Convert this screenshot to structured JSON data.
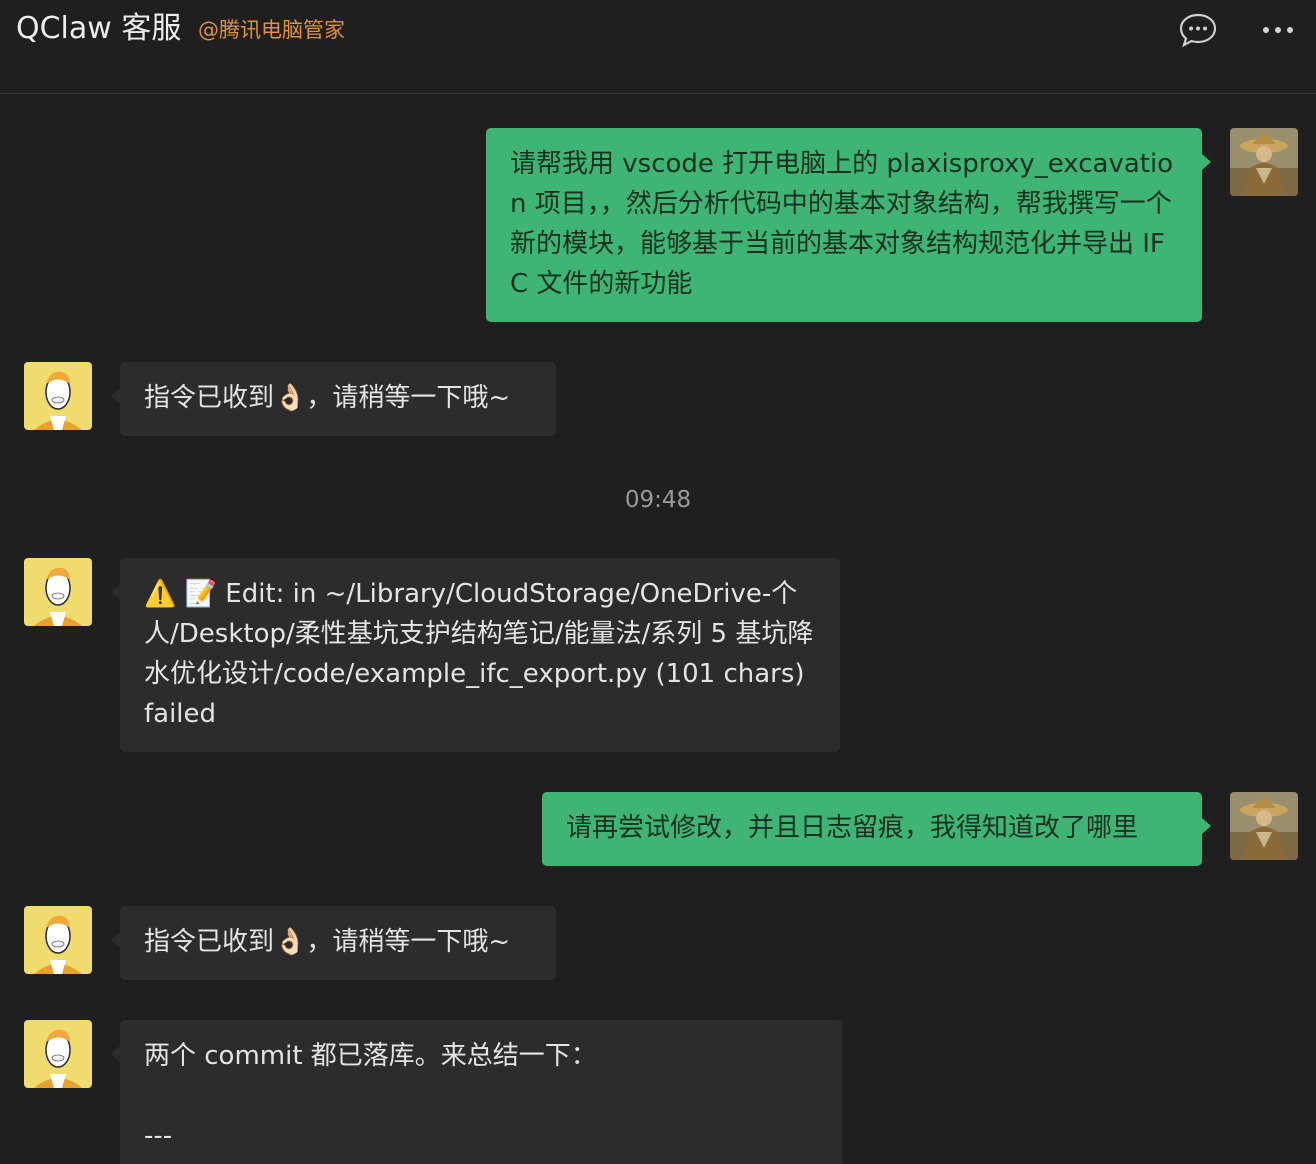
{
  "header": {
    "title": "QClaw 客服",
    "subtitle": "@腾讯电脑管家",
    "chat_icon": "chat-bubble-icon",
    "more_icon": "more-dots-icon"
  },
  "colors": {
    "background": "#1f1f1f",
    "user_bubble": "#3eb575",
    "bot_bubble": "#2c2c2c",
    "subtitle": "#e0913a"
  },
  "messages": [
    {
      "sender": "user",
      "text": "请帮我用 vscode 打开电脑上的 plaxisproxy_excavation 项目，，然后分析代码中的基本对象结构，帮我撰写一个新的模块，能够基于当前的基本对象结构规范化并导出 IFC 文件的新功能"
    },
    {
      "sender": "bot",
      "text": "指令已收到👌🏻，请稍等一下哦~"
    },
    {
      "sender": "bot",
      "text": "⚠️ 📝 Edit: in ~/Library/CloudStorage/OneDrive-个人/Desktop/柔性基坑支护结构笔记/能量法/系列 5 基坑降水优化设计/code/example_ifc_export.py (101 chars) failed"
    },
    {
      "sender": "user",
      "text": "请再尝试修改，并且日志留痕，我得知道改了哪里"
    },
    {
      "sender": "bot",
      "text": "指令已收到👌🏻，请稍等一下哦~"
    },
    {
      "sender": "bot",
      "text": "两个 commit 都已落库。来总结一下：\n\n---"
    }
  ],
  "timestamp": "09:48"
}
